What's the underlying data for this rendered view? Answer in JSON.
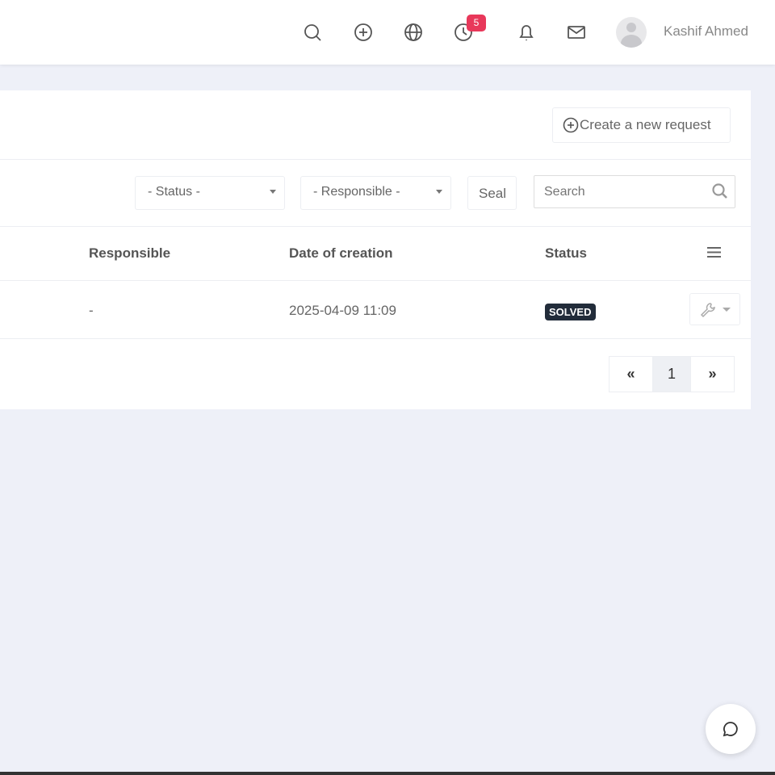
{
  "topbar": {
    "notification_count": "5",
    "user_name": "Kashif Ahmed"
  },
  "toolbar": {
    "create_label": "Create a new request"
  },
  "filters": {
    "status": "- Status -",
    "responsible": "- Responsible -",
    "seal_label": "Seal",
    "search_placeholder": "Search"
  },
  "table": {
    "headers": [
      "Responsible",
      "Date of creation",
      "Status"
    ],
    "rows": [
      {
        "responsible": "-",
        "date": "2025-04-09 11:09",
        "status": "SOLVED"
      }
    ]
  },
  "pagination": {
    "prev": "«",
    "current": "1",
    "next": "»"
  },
  "colors": {
    "badge": "#e8385a",
    "status_solved": "#222c3a"
  }
}
